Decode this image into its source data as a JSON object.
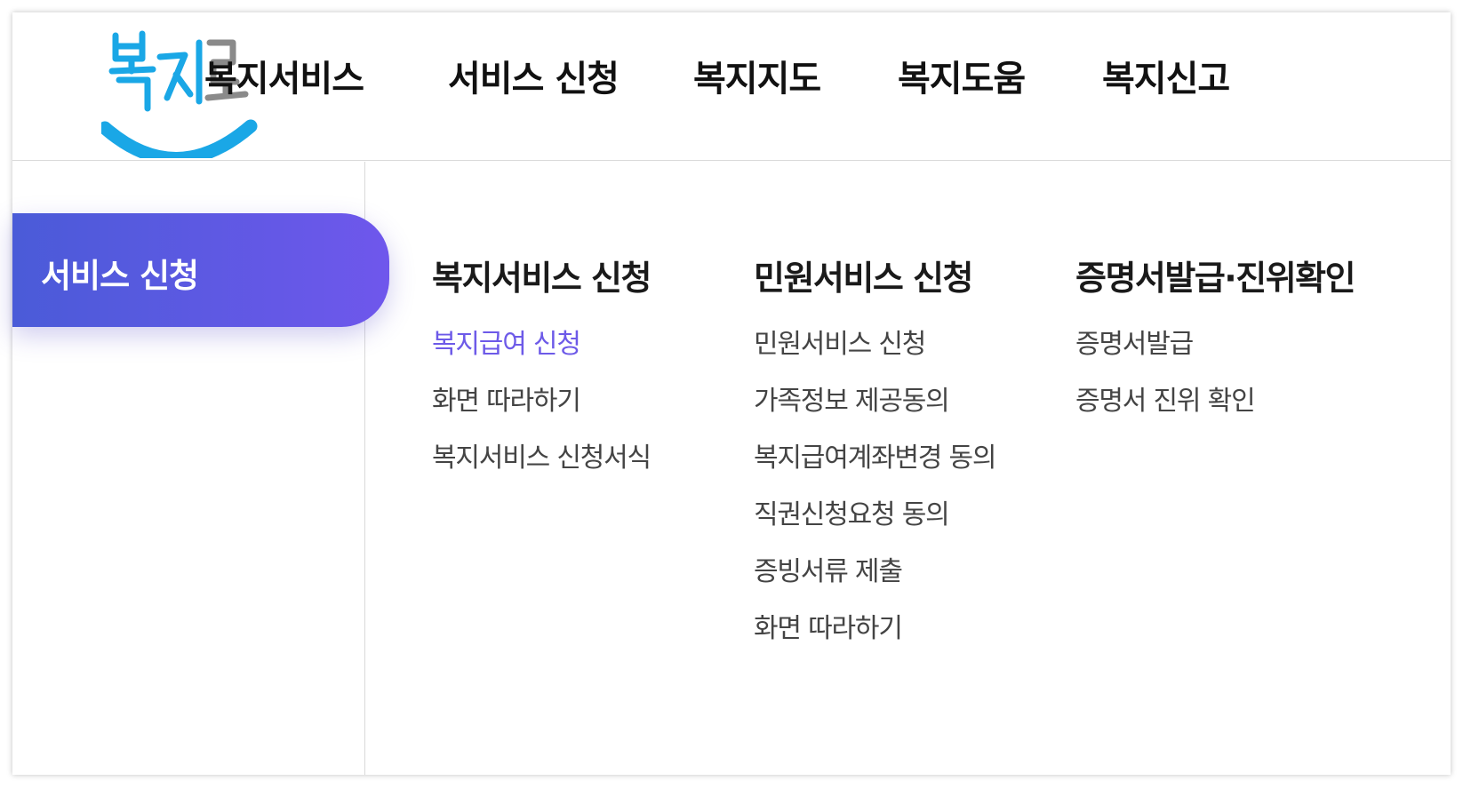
{
  "brand": {
    "logo_text": "복지로",
    "logo_color": "#1aa7e6",
    "logo_secondary_color": "#8a8a8a"
  },
  "top_nav": {
    "items": [
      {
        "label": "복지서비스"
      },
      {
        "label": "서비스 신청"
      },
      {
        "label": "복지지도"
      },
      {
        "label": "복지도움"
      },
      {
        "label": "복지신고"
      }
    ]
  },
  "sidebar": {
    "active_label": "서비스 신청",
    "accent_gradient": [
      "#4a5bd8",
      "#6f57ec"
    ]
  },
  "submenu": {
    "active_color": "#6d5ae8",
    "columns": [
      {
        "title": "복지서비스 신청",
        "links": [
          {
            "label": "복지급여 신청",
            "active": true
          },
          {
            "label": "화면 따라하기",
            "active": false
          },
          {
            "label": "복지서비스 신청서식",
            "active": false
          }
        ]
      },
      {
        "title": "민원서비스 신청",
        "links": [
          {
            "label": "민원서비스 신청",
            "active": false
          },
          {
            "label": "가족정보 제공동의",
            "active": false
          },
          {
            "label": "복지급여계좌변경 동의",
            "active": false
          },
          {
            "label": "직권신청요청 동의",
            "active": false
          },
          {
            "label": "증빙서류 제출",
            "active": false
          },
          {
            "label": "화면 따라하기",
            "active": false
          }
        ]
      },
      {
        "title": "증명서발급·진위확인",
        "links": [
          {
            "label": "증명서발급",
            "active": false
          },
          {
            "label": "증명서 진위 확인",
            "active": false
          }
        ]
      }
    ]
  }
}
